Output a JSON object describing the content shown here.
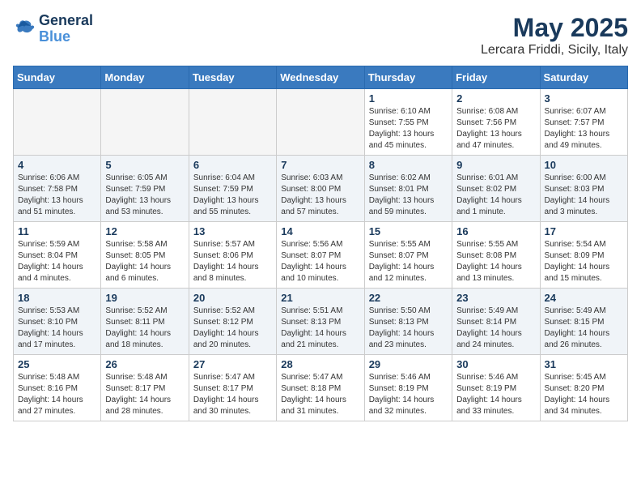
{
  "logo": {
    "line1": "General",
    "line2": "Blue"
  },
  "title": "May 2025",
  "subtitle": "Lercara Friddi, Sicily, Italy",
  "days_of_week": [
    "Sunday",
    "Monday",
    "Tuesday",
    "Wednesday",
    "Thursday",
    "Friday",
    "Saturday"
  ],
  "weeks": [
    [
      {
        "day": "",
        "info": ""
      },
      {
        "day": "",
        "info": ""
      },
      {
        "day": "",
        "info": ""
      },
      {
        "day": "",
        "info": ""
      },
      {
        "day": "1",
        "info": "Sunrise: 6:10 AM\nSunset: 7:55 PM\nDaylight: 13 hours\nand 45 minutes."
      },
      {
        "day": "2",
        "info": "Sunrise: 6:08 AM\nSunset: 7:56 PM\nDaylight: 13 hours\nand 47 minutes."
      },
      {
        "day": "3",
        "info": "Sunrise: 6:07 AM\nSunset: 7:57 PM\nDaylight: 13 hours\nand 49 minutes."
      }
    ],
    [
      {
        "day": "4",
        "info": "Sunrise: 6:06 AM\nSunset: 7:58 PM\nDaylight: 13 hours\nand 51 minutes."
      },
      {
        "day": "5",
        "info": "Sunrise: 6:05 AM\nSunset: 7:59 PM\nDaylight: 13 hours\nand 53 minutes."
      },
      {
        "day": "6",
        "info": "Sunrise: 6:04 AM\nSunset: 7:59 PM\nDaylight: 13 hours\nand 55 minutes."
      },
      {
        "day": "7",
        "info": "Sunrise: 6:03 AM\nSunset: 8:00 PM\nDaylight: 13 hours\nand 57 minutes."
      },
      {
        "day": "8",
        "info": "Sunrise: 6:02 AM\nSunset: 8:01 PM\nDaylight: 13 hours\nand 59 minutes."
      },
      {
        "day": "9",
        "info": "Sunrise: 6:01 AM\nSunset: 8:02 PM\nDaylight: 14 hours\nand 1 minute."
      },
      {
        "day": "10",
        "info": "Sunrise: 6:00 AM\nSunset: 8:03 PM\nDaylight: 14 hours\nand 3 minutes."
      }
    ],
    [
      {
        "day": "11",
        "info": "Sunrise: 5:59 AM\nSunset: 8:04 PM\nDaylight: 14 hours\nand 4 minutes."
      },
      {
        "day": "12",
        "info": "Sunrise: 5:58 AM\nSunset: 8:05 PM\nDaylight: 14 hours\nand 6 minutes."
      },
      {
        "day": "13",
        "info": "Sunrise: 5:57 AM\nSunset: 8:06 PM\nDaylight: 14 hours\nand 8 minutes."
      },
      {
        "day": "14",
        "info": "Sunrise: 5:56 AM\nSunset: 8:07 PM\nDaylight: 14 hours\nand 10 minutes."
      },
      {
        "day": "15",
        "info": "Sunrise: 5:55 AM\nSunset: 8:07 PM\nDaylight: 14 hours\nand 12 minutes."
      },
      {
        "day": "16",
        "info": "Sunrise: 5:55 AM\nSunset: 8:08 PM\nDaylight: 14 hours\nand 13 minutes."
      },
      {
        "day": "17",
        "info": "Sunrise: 5:54 AM\nSunset: 8:09 PM\nDaylight: 14 hours\nand 15 minutes."
      }
    ],
    [
      {
        "day": "18",
        "info": "Sunrise: 5:53 AM\nSunset: 8:10 PM\nDaylight: 14 hours\nand 17 minutes."
      },
      {
        "day": "19",
        "info": "Sunrise: 5:52 AM\nSunset: 8:11 PM\nDaylight: 14 hours\nand 18 minutes."
      },
      {
        "day": "20",
        "info": "Sunrise: 5:52 AM\nSunset: 8:12 PM\nDaylight: 14 hours\nand 20 minutes."
      },
      {
        "day": "21",
        "info": "Sunrise: 5:51 AM\nSunset: 8:13 PM\nDaylight: 14 hours\nand 21 minutes."
      },
      {
        "day": "22",
        "info": "Sunrise: 5:50 AM\nSunset: 8:13 PM\nDaylight: 14 hours\nand 23 minutes."
      },
      {
        "day": "23",
        "info": "Sunrise: 5:49 AM\nSunset: 8:14 PM\nDaylight: 14 hours\nand 24 minutes."
      },
      {
        "day": "24",
        "info": "Sunrise: 5:49 AM\nSunset: 8:15 PM\nDaylight: 14 hours\nand 26 minutes."
      }
    ],
    [
      {
        "day": "25",
        "info": "Sunrise: 5:48 AM\nSunset: 8:16 PM\nDaylight: 14 hours\nand 27 minutes."
      },
      {
        "day": "26",
        "info": "Sunrise: 5:48 AM\nSunset: 8:17 PM\nDaylight: 14 hours\nand 28 minutes."
      },
      {
        "day": "27",
        "info": "Sunrise: 5:47 AM\nSunset: 8:17 PM\nDaylight: 14 hours\nand 30 minutes."
      },
      {
        "day": "28",
        "info": "Sunrise: 5:47 AM\nSunset: 8:18 PM\nDaylight: 14 hours\nand 31 minutes."
      },
      {
        "day": "29",
        "info": "Sunrise: 5:46 AM\nSunset: 8:19 PM\nDaylight: 14 hours\nand 32 minutes."
      },
      {
        "day": "30",
        "info": "Sunrise: 5:46 AM\nSunset: 8:19 PM\nDaylight: 14 hours\nand 33 minutes."
      },
      {
        "day": "31",
        "info": "Sunrise: 5:45 AM\nSunset: 8:20 PM\nDaylight: 14 hours\nand 34 minutes."
      }
    ]
  ]
}
